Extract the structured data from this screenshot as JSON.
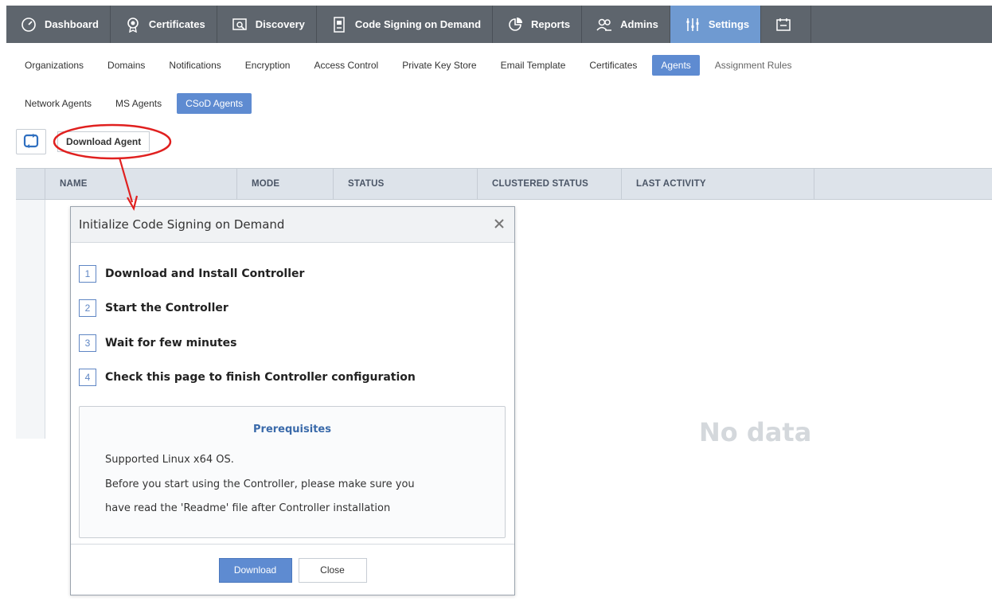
{
  "topnav": {
    "items": [
      {
        "label": "Dashboard",
        "icon": "dashboard-gauge-icon"
      },
      {
        "label": "Certificates",
        "icon": "certificate-badge-icon"
      },
      {
        "label": "Discovery",
        "icon": "discovery-icon"
      },
      {
        "label": "Code Signing on Demand",
        "icon": "code-signing-icon"
      },
      {
        "label": "Reports",
        "icon": "reports-icon"
      },
      {
        "label": "Admins",
        "icon": "admins-icon"
      },
      {
        "label": "Settings",
        "icon": "settings-sliders-icon"
      },
      {
        "label": "",
        "icon": "more-icon"
      }
    ],
    "active": "Settings"
  },
  "subtabs": [
    "Organizations",
    "Domains",
    "Notifications",
    "Encryption",
    "Access Control",
    "Private Key Store",
    "Email Template",
    "Certificates",
    "Agents",
    "Assignment Rules"
  ],
  "subtabs_active": "Agents",
  "agent_tabs": [
    "Network Agents",
    "MS Agents",
    "CSoD Agents"
  ],
  "agent_tabs_active": "CSoD Agents",
  "toolbar": {
    "download_agent_label": "Download Agent"
  },
  "grid": {
    "columns": [
      "NAME",
      "MODE",
      "STATUS",
      "CLUSTERED STATUS",
      "LAST ACTIVITY"
    ],
    "empty_text": "No data"
  },
  "dialog": {
    "title": "Initialize Code Signing on Demand",
    "steps": [
      {
        "num": "1",
        "text": "Download and Install Controller"
      },
      {
        "num": "2",
        "text": "Start the Controller"
      },
      {
        "num": "3",
        "text": "Wait for few minutes"
      },
      {
        "num": "4",
        "text": "Check this page to finish Controller configuration"
      }
    ],
    "prereq_title": "Prerequisites",
    "prereq_lines": [
      "Supported Linux x64 OS.",
      "Before you start using the Controller, please make sure you",
      "have read the 'Readme' file after Controller installation"
    ],
    "download_label": "Download",
    "close_label": "Close"
  },
  "colors": {
    "nav_bg": "#5e656d",
    "nav_active": "#6f9ad1",
    "accent": "#5e8bd1",
    "annotation": "#e0201f"
  }
}
